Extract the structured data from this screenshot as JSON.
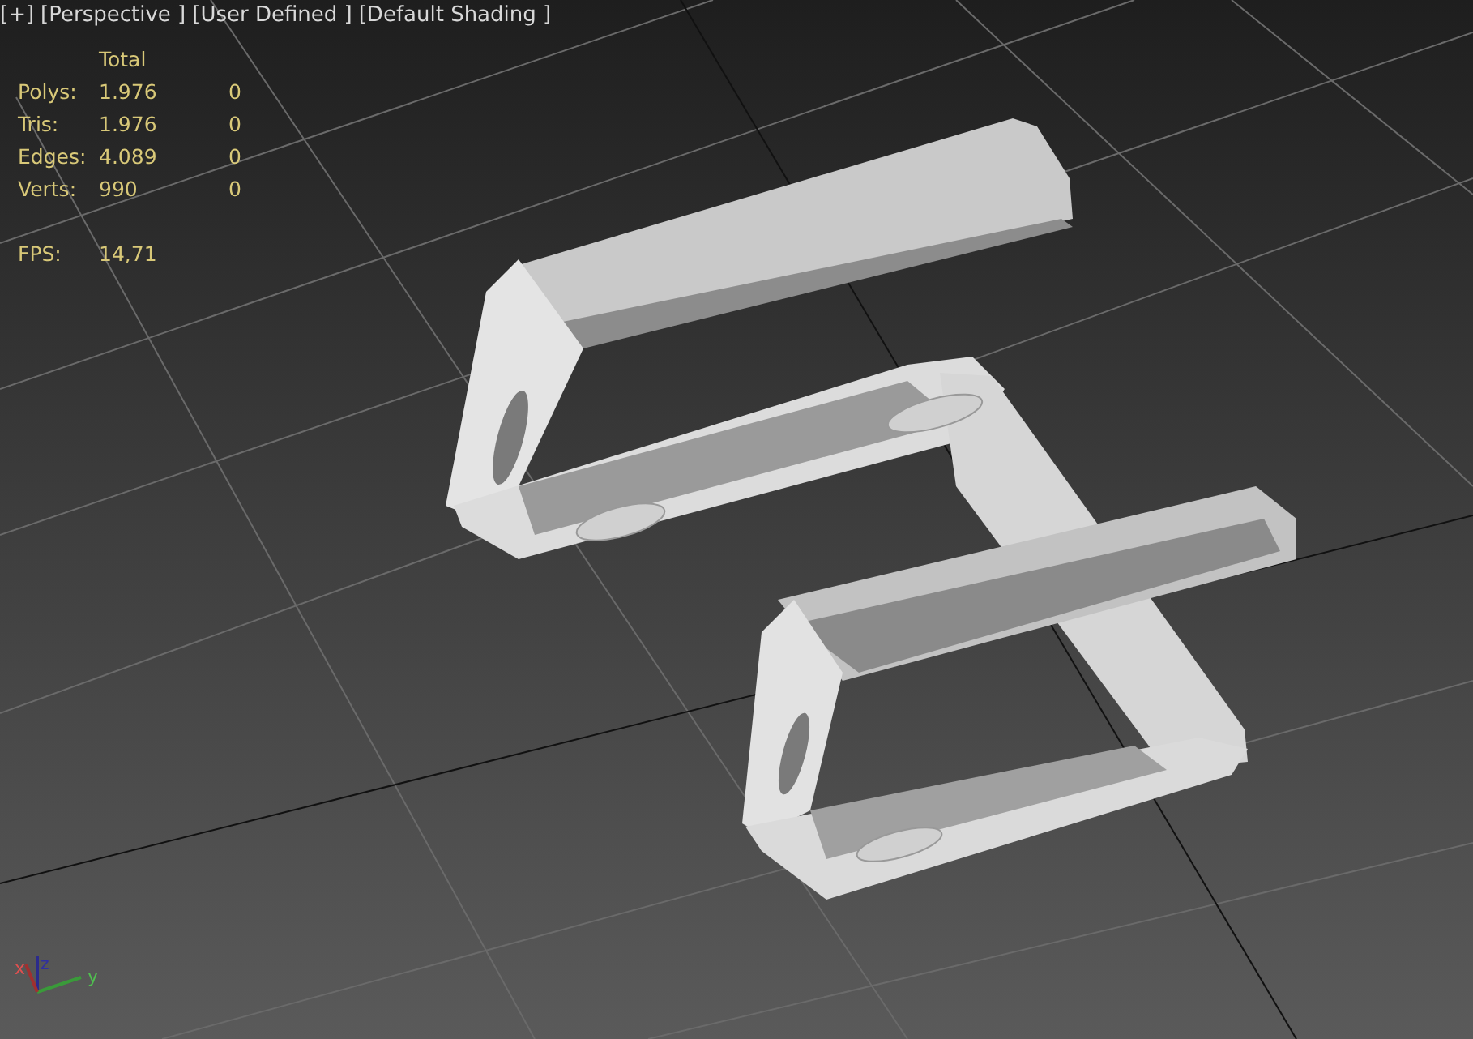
{
  "viewport_labels": [
    {
      "text": "[+]"
    },
    {
      "text": "[Perspective ]"
    },
    {
      "text": "[User Defined ]"
    },
    {
      "text": "[Default Shading ]"
    }
  ],
  "stats": {
    "header": "Total",
    "rows": [
      {
        "label": "Polys:",
        "total": "1.976",
        "selected": "0"
      },
      {
        "label": "Tris:",
        "total": "1.976",
        "selected": "0"
      },
      {
        "label": "Edges:",
        "total": "4.089",
        "selected": "0"
      },
      {
        "label": "Verts:",
        "total": "990",
        "selected": "0"
      }
    ],
    "fps_label": "FPS:",
    "fps_value": "14,71"
  },
  "axis_labels": {
    "x": "x",
    "y": "y",
    "z": "z"
  }
}
